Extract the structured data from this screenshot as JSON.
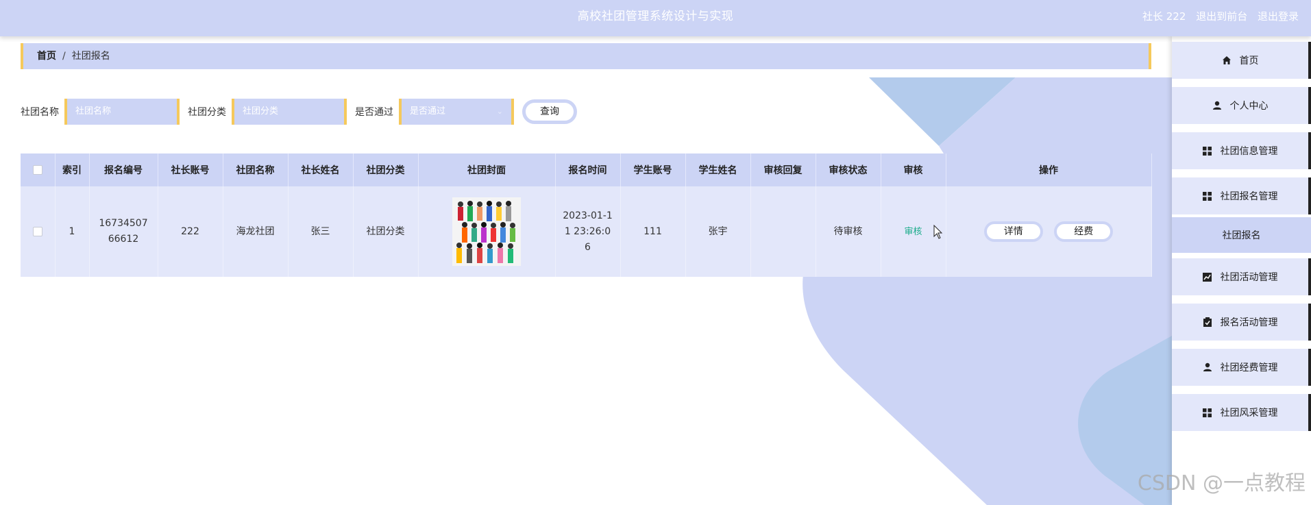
{
  "header": {
    "title": "高校社团管理系统设计与实现",
    "user": "社长 222",
    "back_front": "退出到前台",
    "logout": "退出登录"
  },
  "breadcrumb": {
    "home": "首页",
    "separator": "/",
    "current": "社团报名"
  },
  "search": {
    "club_name_label": "社团名称",
    "club_name_placeholder": "社团名称",
    "category_label": "社团分类",
    "category_placeholder": "社团分类",
    "passed_label": "是否通过",
    "passed_placeholder": "是否通过",
    "query_button": "查询"
  },
  "table": {
    "headers": [
      "索引",
      "报名编号",
      "社长账号",
      "社团名称",
      "社长姓名",
      "社团分类",
      "社团封面",
      "报名时间",
      "学生账号",
      "学生姓名",
      "审核回复",
      "审核状态",
      "审核",
      "操作"
    ],
    "rows": [
      {
        "index": "1",
        "reg_no": "1673450766612",
        "leader_account": "222",
        "club_name": "海龙社团",
        "leader_name": "张三",
        "category": "社团分类",
        "reg_time": "2023-01-11 23:26:06",
        "student_account": "111",
        "student_name": "张宇",
        "audit_reply": "",
        "audit_status": "待审核",
        "audit_action": "审核",
        "detail_button": "详情",
        "fee_button": "经费"
      }
    ]
  },
  "sidebar": {
    "items": [
      {
        "label": "首页",
        "icon": "home-icon"
      },
      {
        "label": "个人中心",
        "icon": "user-icon"
      },
      {
        "label": "社团信息管理",
        "icon": "grid-icon"
      },
      {
        "label": "社团报名管理",
        "icon": "grid-icon"
      },
      {
        "label": "社团活动管理",
        "icon": "chart-icon"
      },
      {
        "label": "报名活动管理",
        "icon": "clipboard-check-icon"
      },
      {
        "label": "社团经费管理",
        "icon": "user-icon"
      },
      {
        "label": "社团风采管理",
        "icon": "grid-icon"
      }
    ],
    "active_sub": "社团报名"
  },
  "watermark": "CSDN @一点教程",
  "colors": {
    "accent": "#ccd4f5",
    "row": "#e3e7fa",
    "gold": "#f5c95c",
    "audit": "#1aab8a"
  }
}
